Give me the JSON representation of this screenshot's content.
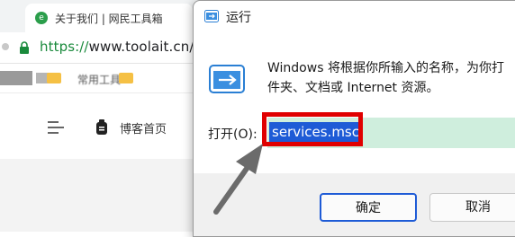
{
  "browser": {
    "tab": {
      "title": "关于我们 | 网民工具箱",
      "favicon": "globe-icon"
    },
    "address": {
      "scheme": "https://",
      "rest": "www.toolait.cn/ab"
    },
    "bookmarks": {
      "blurred_label": "常用工具"
    },
    "page": {
      "nav_label": "博客首页"
    }
  },
  "run_dialog": {
    "title": "运行",
    "description_line1": "Windows 将根据你所输入的名称，为你打",
    "description_line2": "件夹、文档或 Internet 资源。",
    "open_label": "打开(O):",
    "input_value": "services.msc",
    "ok_label": "确定",
    "cancel_label": "取消"
  },
  "colors": {
    "highlight_border": "#e00000",
    "selection": "#1e5bd6",
    "input_background": "#cfeedd",
    "arrow": "#6b6b6b"
  }
}
